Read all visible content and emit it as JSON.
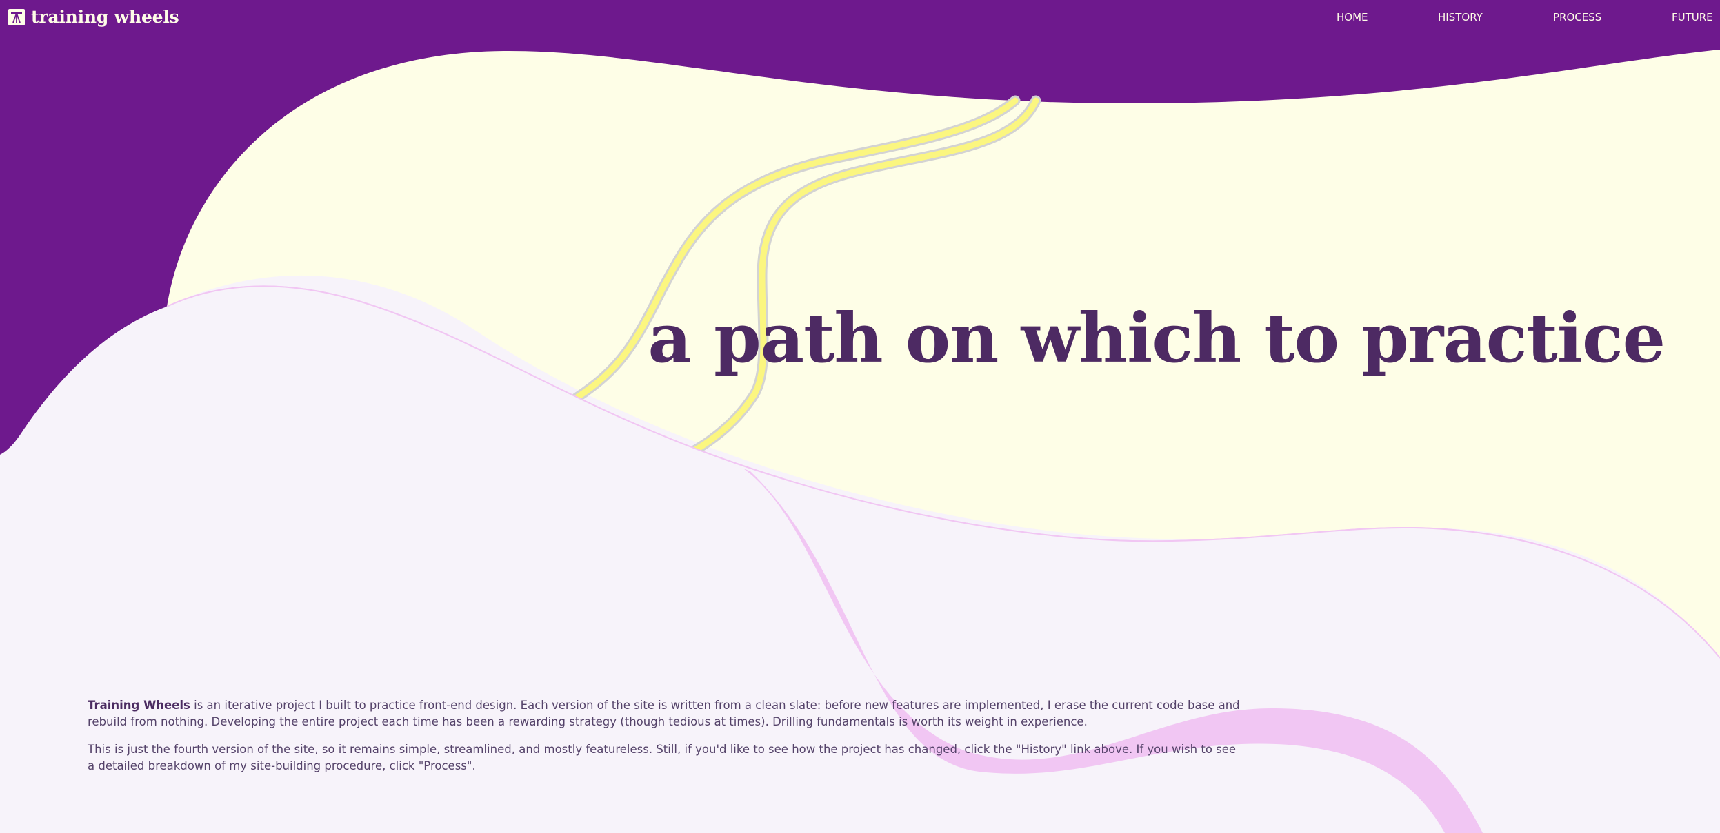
{
  "header": {
    "site_name": "training wheels",
    "logo_icon": "bicycle-path-icon",
    "nav": {
      "home": "HOME",
      "history": "HISTORY",
      "process": "PROCESS",
      "future": "FUTURE"
    }
  },
  "hero": {
    "headline": "a path on which to practice"
  },
  "intro": {
    "p1_strong": "Training Wheels",
    "p1_text": " is an iterative project I built to practice front-end design. Each version of the site is written from a clean slate: before new features are implemented, I erase the current code base and rebuild from nothing. Developing the entire project each time has been a rewarding strategy (though tedious at times). Drilling fundamentals is worth its weight in experience.",
    "p2_text": "This is just the fourth version of the site, so it remains simple, streamlined, and mostly featureless. Still, if you'd like to see how the project has changed, click the \"History\" link above. If you wish to see a detailed breakdown of my site-building procedure, click \"Process\"."
  },
  "colors": {
    "header_purple": "#6e198d",
    "cream": "#fefee7",
    "lavender": "#f7f3fa",
    "pink_path": "#f1c6f3",
    "yellow_path": "#fbf680",
    "headline": "#4d2a63",
    "body_text": "#55436a"
  }
}
